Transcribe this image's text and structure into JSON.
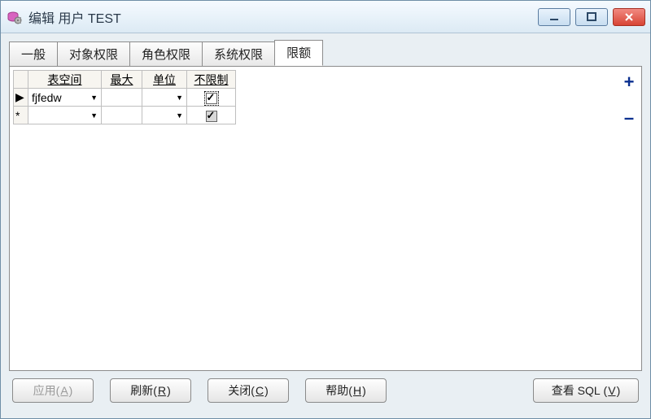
{
  "window": {
    "title": "编辑 用户 TEST"
  },
  "tabs": [
    {
      "label": "一般"
    },
    {
      "label": "对象权限"
    },
    {
      "label": "角色权限"
    },
    {
      "label": "系统权限"
    },
    {
      "label": "限额",
      "active": true
    }
  ],
  "grid": {
    "headers": {
      "tablespace": "表空间",
      "max": "最大",
      "unit": "单位",
      "unlimited": "不限制"
    },
    "rows": [
      {
        "marker": "▶",
        "tablespace": "fjfedw",
        "max": "",
        "unit": "",
        "unlimited": true,
        "focused": true
      },
      {
        "marker": "*",
        "tablespace": "",
        "max": "",
        "unit": "",
        "unlimited": false,
        "gray": true
      }
    ]
  },
  "side": {
    "plus": "+",
    "minus": "–"
  },
  "buttons": {
    "apply": {
      "text": "应用",
      "mn": "A"
    },
    "refresh": {
      "text": "刷新",
      "mn": "R"
    },
    "close": {
      "text": "关闭",
      "mn": "C"
    },
    "help": {
      "text": "帮助",
      "mn": "H"
    },
    "sql": {
      "text": "查看 SQL",
      "mn": "V"
    }
  }
}
